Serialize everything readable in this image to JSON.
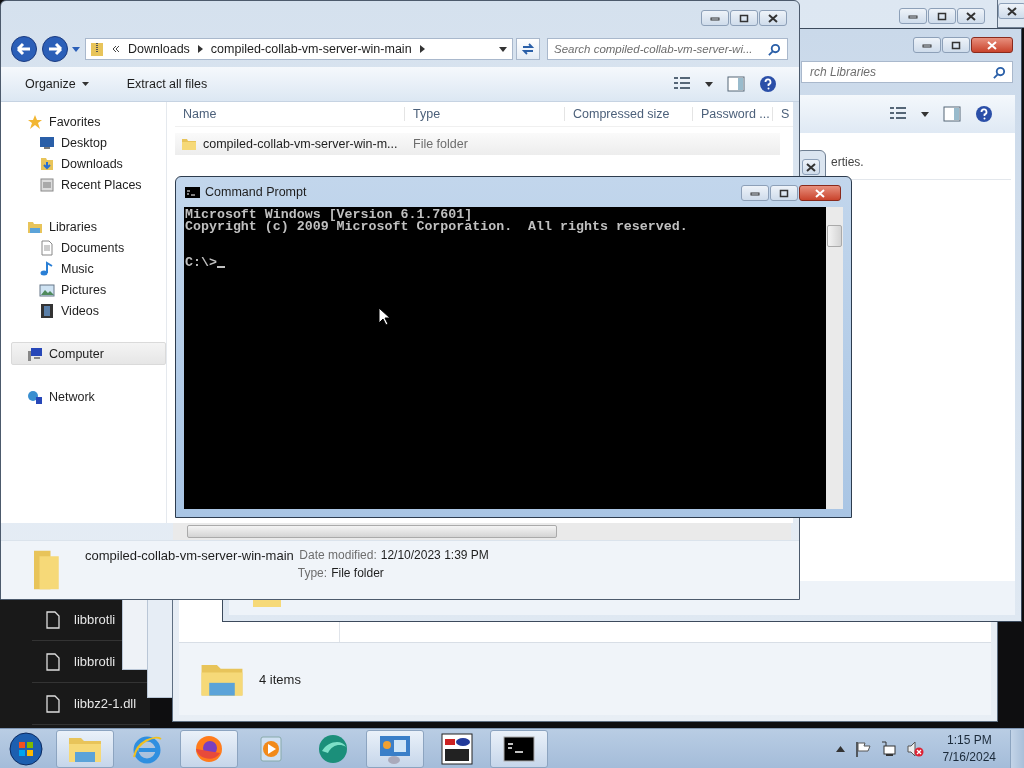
{
  "background_list": {
    "files": [
      {
        "name": "libbrotli"
      },
      {
        "name": "libbrotli"
      },
      {
        "name": "libbz2-1.dll"
      }
    ]
  },
  "back_window": {
    "status": "4 items"
  },
  "libraries_window": {
    "search_placeholder": "rch Libraries",
    "info_text": "erties."
  },
  "zip_window": {
    "breadcrumb": [
      "Downloads",
      "compiled-collab-vm-server-win-main"
    ],
    "search_placeholder": "Search compiled-collab-vm-server-wi...",
    "toolbar": [
      "Organize",
      "Extract all files"
    ],
    "nav": [
      {
        "label": "Favorites",
        "kind": "favorites",
        "selected": false,
        "children": [
          {
            "label": "Desktop",
            "kind": "desktop",
            "selected": false
          },
          {
            "label": "Downloads",
            "kind": "downloads",
            "selected": false
          },
          {
            "label": "Recent Places",
            "kind": "recent",
            "selected": false
          }
        ]
      },
      {
        "label": "Libraries",
        "kind": "libraries",
        "selected": false,
        "children": [
          {
            "label": "Documents",
            "kind": "documents",
            "selected": false
          },
          {
            "label": "Music",
            "kind": "music",
            "selected": false
          },
          {
            "label": "Pictures",
            "kind": "pictures",
            "selected": false
          },
          {
            "label": "Videos",
            "kind": "videos",
            "selected": false
          }
        ]
      },
      {
        "label": "Computer",
        "kind": "computer",
        "selected": true
      },
      {
        "label": "Network",
        "kind": "network",
        "selected": false
      }
    ],
    "columns": [
      "Name",
      "Type",
      "Compressed size",
      "Password ...",
      "S"
    ],
    "rows": [
      {
        "name": "compiled-collab-vm-server-win-m...",
        "type": "File folder",
        "selected": true
      }
    ],
    "details": {
      "name": "compiled-collab-vm-server-win-main",
      "fields": [
        {
          "label": "Date modified:",
          "value": "12/10/2023 1:39 PM"
        },
        {
          "label": "Type:",
          "value": "File folder"
        }
      ]
    }
  },
  "cmd_window": {
    "title": "Command Prompt",
    "lines": [
      "Microsoft Windows [Version 6.1.7601]",
      "Copyright (c) 2009 Microsoft Corporation.  All rights reserved."
    ],
    "prompt": "C:\\>"
  },
  "taskbar": {
    "items": [
      {
        "kind": "explorer",
        "running": true
      },
      {
        "kind": "ie",
        "running": false
      },
      {
        "kind": "firefox",
        "running": true
      },
      {
        "kind": "media",
        "running": false
      },
      {
        "kind": "app",
        "running": false
      },
      {
        "kind": "control-panel",
        "running": true
      },
      {
        "kind": "vnc",
        "running": false
      },
      {
        "kind": "cmd",
        "running": true
      }
    ],
    "clock": {
      "time": "1:15 PM",
      "date": "7/16/2024"
    }
  }
}
